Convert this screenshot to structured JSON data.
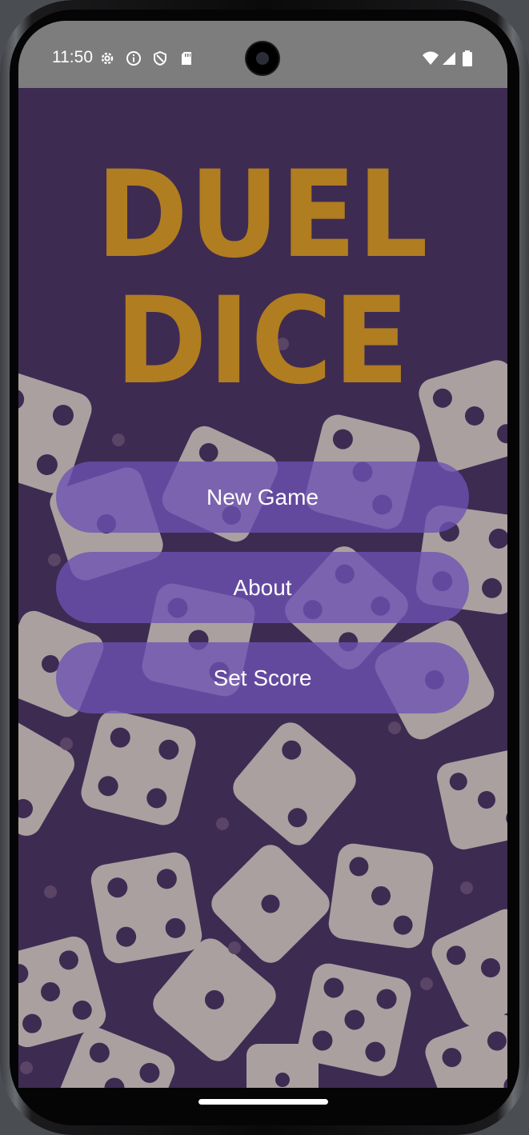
{
  "status_bar": {
    "time": "11:50",
    "left_icons": [
      "settings-icon",
      "info-icon",
      "shield-icon",
      "sd-card-icon"
    ],
    "right_icons": [
      "wifi-icon",
      "signal-icon",
      "battery-icon"
    ]
  },
  "app": {
    "title_line1": "DUEL",
    "title_line2": "DICE",
    "buttons": [
      {
        "label": "New Game"
      },
      {
        "label": "About"
      },
      {
        "label": "Set Score"
      }
    ]
  },
  "colors": {
    "background": "#3e2b52",
    "title": "#b07d21",
    "dice": "#aaa09f",
    "pip": "#3e2b52",
    "button": "#6e52b4"
  }
}
